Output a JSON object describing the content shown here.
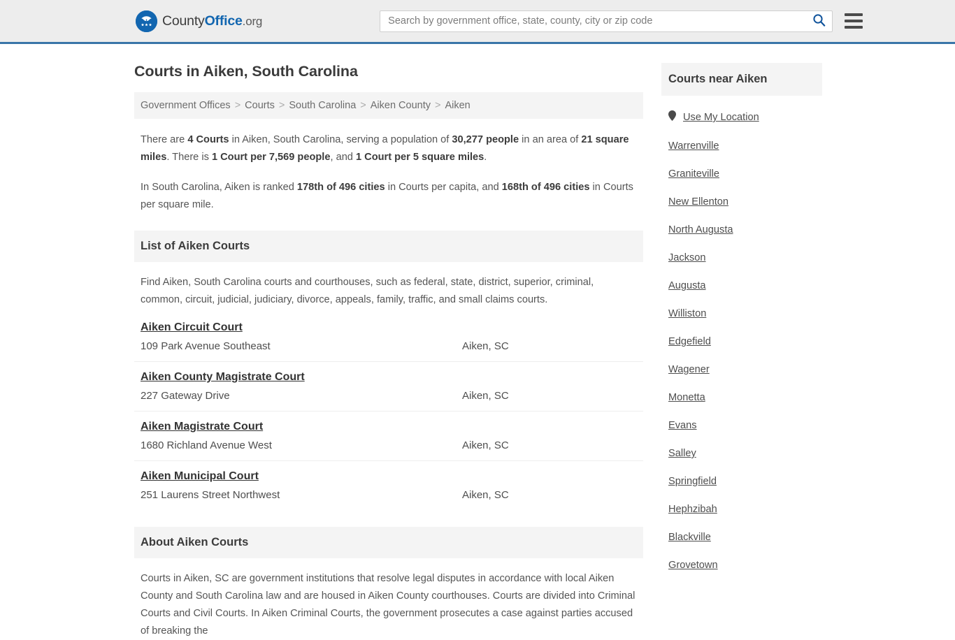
{
  "header": {
    "brand": {
      "logo_icon": "countyoffice-eagle-logo",
      "part1": "County",
      "part2": "Office",
      "part3": ".org"
    },
    "search": {
      "placeholder": "Search by government office, state, county, city or zip code",
      "value": "",
      "search_icon": "search-icon"
    },
    "menu_icon": "hamburger-menu-icon",
    "accent_color": "#3a76a8",
    "background_color": "#ededed"
  },
  "main": {
    "page_title": "Courts in Aiken, South Carolina",
    "breadcrumb": {
      "separator": ">",
      "items": [
        {
          "label": "Government Offices"
        },
        {
          "label": "Courts"
        },
        {
          "label": "South Carolina"
        },
        {
          "label": "Aiken County"
        },
        {
          "label": "Aiken"
        }
      ]
    },
    "stats": {
      "paragraph1": [
        {
          "text": "There are ",
          "bold": false
        },
        {
          "text": "4 Courts",
          "bold": true
        },
        {
          "text": " in Aiken, South Carolina, serving a population of ",
          "bold": false
        },
        {
          "text": "30,277 people",
          "bold": true
        },
        {
          "text": " in an area of ",
          "bold": false
        },
        {
          "text": "21 square miles",
          "bold": true
        },
        {
          "text": ". There is ",
          "bold": false
        },
        {
          "text": "1 Court per 7,569 people",
          "bold": true
        },
        {
          "text": ", and ",
          "bold": false
        },
        {
          "text": "1 Court per 5 square miles",
          "bold": true
        },
        {
          "text": ".",
          "bold": false
        }
      ],
      "paragraph2": [
        {
          "text": "In South Carolina, Aiken is ranked ",
          "bold": false
        },
        {
          "text": "178th of 496 cities",
          "bold": true
        },
        {
          "text": " in Courts per capita, and ",
          "bold": false
        },
        {
          "text": "168th of 496 cities",
          "bold": true
        },
        {
          "text": " in Courts per square mile.",
          "bold": false
        }
      ]
    },
    "list_section": {
      "heading": "List of Aiken Courts",
      "intro": "Find Aiken, South Carolina courts and courthouses, such as federal, state, district, superior, criminal, common, circuit, judicial, judiciary, divorce, appeals, family, traffic, and small claims courts.",
      "courts": [
        {
          "name": "Aiken Circuit Court",
          "address": "109 Park Avenue Southeast",
          "city": "Aiken, SC"
        },
        {
          "name": "Aiken County Magistrate Court",
          "address": "227 Gateway Drive",
          "city": "Aiken, SC"
        },
        {
          "name": "Aiken Magistrate Court",
          "address": "1680 Richland Avenue West",
          "city": "Aiken, SC"
        },
        {
          "name": "Aiken Municipal Court",
          "address": "251 Laurens Street Northwest",
          "city": "Aiken, SC"
        }
      ]
    },
    "about_section": {
      "heading": "About Aiken Courts",
      "body": "Courts in Aiken, SC are government institutions that resolve legal disputes in accordance with local Aiken County and South Carolina law and are housed in Aiken County courthouses. Courts are divided into Criminal Courts and Civil Courts. In Aiken Criminal Courts, the government prosecutes a case against parties accused of breaking the"
    }
  },
  "sidebar": {
    "heading": "Courts near Aiken",
    "use_my_location": {
      "label": "Use My Location",
      "icon": "map-pin-icon"
    },
    "places": [
      {
        "label": "Warrenville"
      },
      {
        "label": "Graniteville"
      },
      {
        "label": "New Ellenton"
      },
      {
        "label": "North Augusta"
      },
      {
        "label": "Jackson"
      },
      {
        "label": "Augusta"
      },
      {
        "label": "Williston"
      },
      {
        "label": "Edgefield"
      },
      {
        "label": "Wagener"
      },
      {
        "label": "Monetta"
      },
      {
        "label": "Evans"
      },
      {
        "label": "Salley"
      },
      {
        "label": "Springfield"
      },
      {
        "label": "Hephzibah"
      },
      {
        "label": "Blackville"
      },
      {
        "label": "Grovetown"
      }
    ]
  }
}
